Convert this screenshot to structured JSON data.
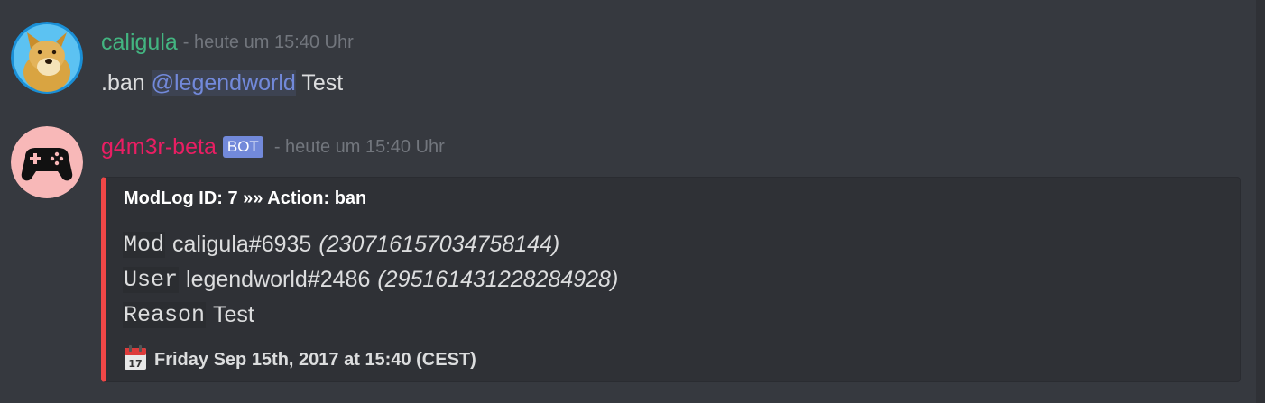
{
  "messages": [
    {
      "username": "caligula",
      "timestamp": "heute um 15:40 Uhr",
      "content_prefix": ".ban",
      "mention": "@legendworld",
      "content_suffix": "Test",
      "avatar": "doge-avatar"
    },
    {
      "username": "g4m3r-beta",
      "badge": "BOT",
      "timestamp": "heute um 15:40 Uhr",
      "avatar": "gamepad-avatar",
      "embed": {
        "accent_color": "#f04747",
        "title": "ModLog ID: 7 »» Action: ban",
        "fields": [
          {
            "key": "Mod",
            "value": "caligula#6935",
            "id": "(230716157034758144)"
          },
          {
            "key": "User",
            "value": "legendworld#2486",
            "id": "(295161431228284928)"
          },
          {
            "key": "Reason",
            "value": "Test",
            "id": ""
          }
        ],
        "footer_icon": "calendar-icon",
        "footer_text": "Friday Sep 15th, 2017 at 15:40 (CEST)"
      }
    }
  ],
  "colors": {
    "background": "#36393f",
    "username_user": "#43b581",
    "username_bot": "#e91e63",
    "mention": "#7289da",
    "badge": "#7289da"
  }
}
